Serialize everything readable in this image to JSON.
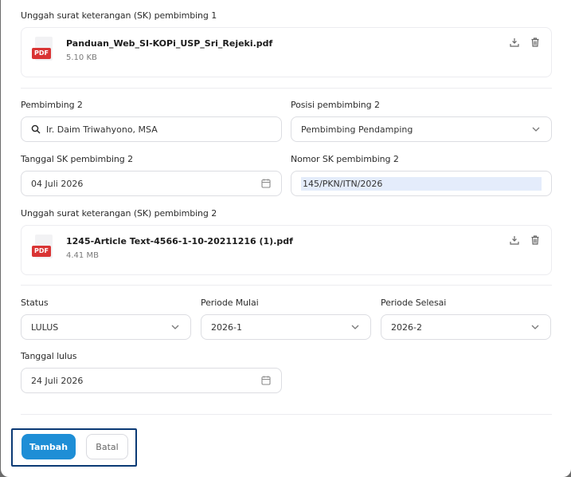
{
  "upload1": {
    "label": "Unggah surat keterangan (SK) pembimbing 1",
    "file_name": "Panduan_Web_SI-KOPi_USP_Sri_Rejeki.pdf",
    "file_size": "5.10 KB",
    "badge": "PDF"
  },
  "pembimbing2": {
    "label": "Pembimbing 2",
    "value": "Ir. Daim Triwahyono, MSA"
  },
  "posisi2": {
    "label": "Posisi pembimbing 2",
    "value": "Pembimbing Pendamping"
  },
  "tanggal_sk2": {
    "label": "Tanggal SK pembimbing 2",
    "value": "04 Juli 2026"
  },
  "nomor_sk2": {
    "label": "Nomor SK pembimbing 2",
    "value": "145/PKN/ITN/2026"
  },
  "upload2": {
    "label": "Unggah surat keterangan (SK) pembimbing 2",
    "file_name": "1245-Article Text-4566-1-10-20211216 (1).pdf",
    "file_size": "4.41 MB",
    "badge": "PDF"
  },
  "status": {
    "label": "Status",
    "value": "LULUS"
  },
  "periode_mulai": {
    "label": "Periode Mulai",
    "value": "2026-1"
  },
  "periode_selesai": {
    "label": "Periode Selesai",
    "value": "2026-2"
  },
  "tanggal_lulus": {
    "label": "Tanggal lulus",
    "value": "24 Juli 2026"
  },
  "actions": {
    "submit_label": "Tambah",
    "cancel_label": "Batal"
  },
  "colors": {
    "primary": "#1e8ed6",
    "pdf_badge": "#d93434",
    "focus_outline": "#0b3a75"
  }
}
